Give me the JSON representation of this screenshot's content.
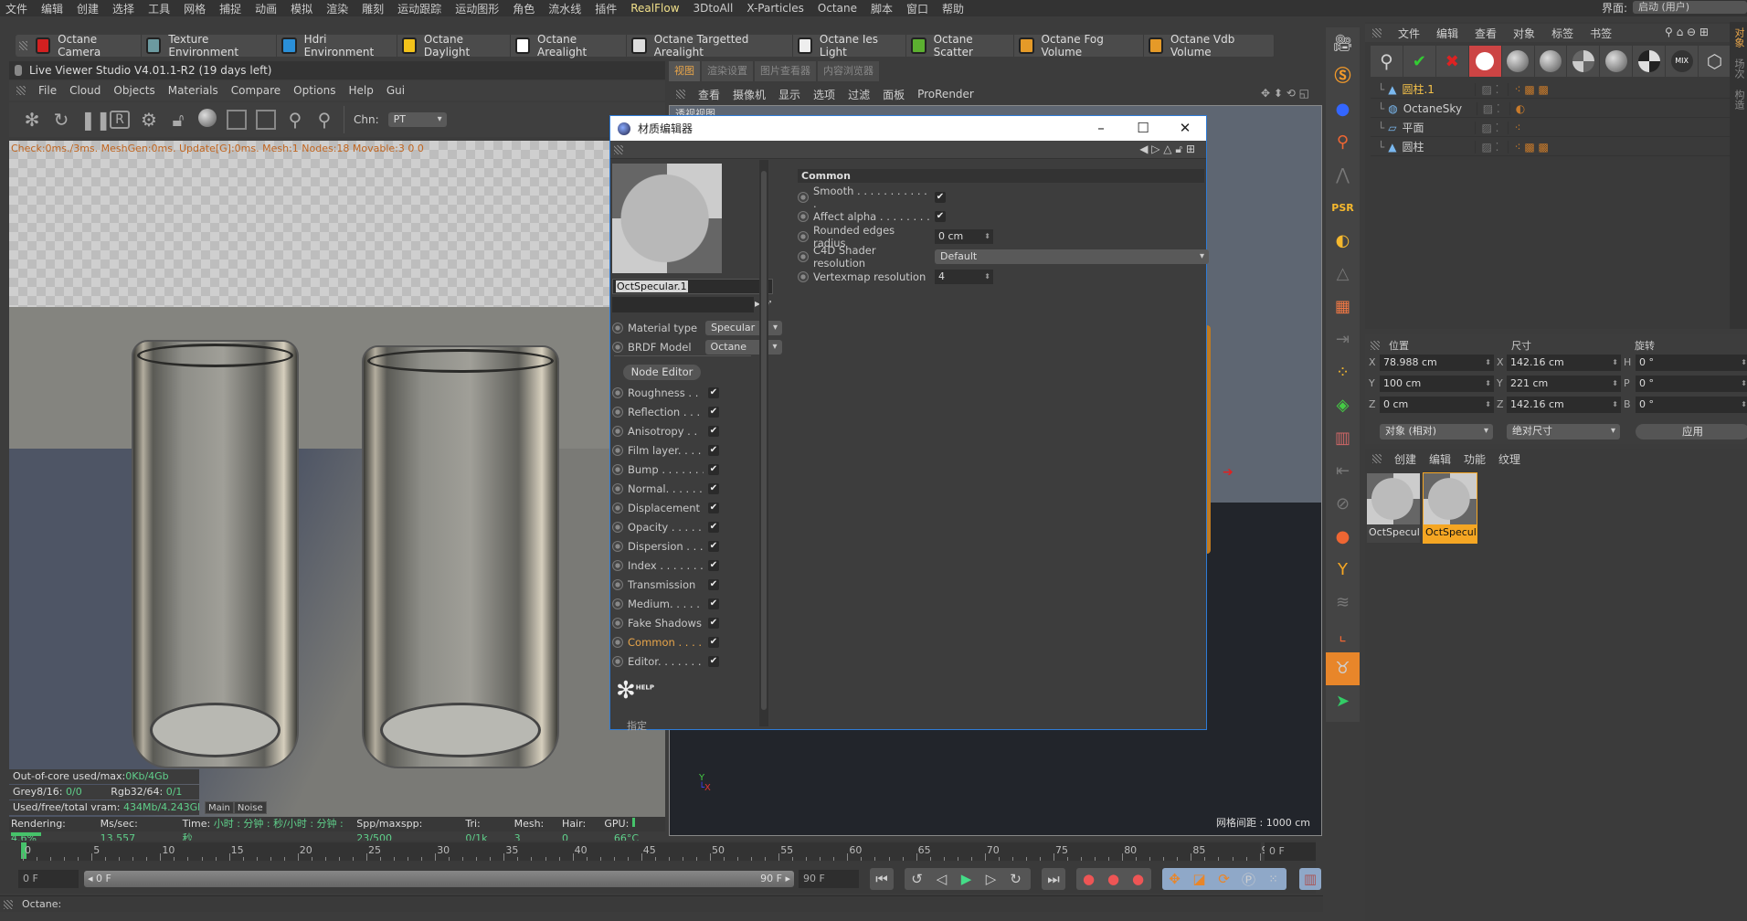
{
  "menubar": {
    "items": [
      "文件",
      "编辑",
      "创建",
      "选择",
      "工具",
      "网格",
      "捕捉",
      "动画",
      "模拟",
      "渲染",
      "雕刻",
      "运动跟踪",
      "运动图形",
      "角色",
      "流水线",
      "插件",
      "RealFlow",
      "3DtoAll",
      "X-Particles",
      "Octane",
      "脚本",
      "窗口",
      "帮助"
    ],
    "highlight": "RealFlow"
  },
  "interface": {
    "label": "界面:",
    "value": "启动 (用户)"
  },
  "octane_toolbar": [
    {
      "label": "Octane Camera",
      "icon": "camera-icon",
      "color": "#d32020"
    },
    {
      "label": "Texture Environment",
      "icon": "texture-env-icon",
      "color": "#6c9aa0"
    },
    {
      "label": "Hdri Environment",
      "icon": "hdri-env-icon",
      "color": "#2a8fd8"
    },
    {
      "label": "Octane Daylight",
      "icon": "sun-icon",
      "color": "#f2c21a"
    },
    {
      "label": "Octane Arealight",
      "icon": "arealight-icon",
      "color": "#ffffff"
    },
    {
      "label": "Octane Targetted Arealight",
      "icon": "targetted-light-icon",
      "color": "#dddddd"
    },
    {
      "label": "Octane Ies Light",
      "icon": "ies-light-icon",
      "color": "#eeeeee"
    },
    {
      "label": "Octane Scatter",
      "icon": "scatter-icon",
      "color": "#5cb030"
    },
    {
      "label": "Octane Fog Volume",
      "icon": "fog-volume-icon",
      "color": "#e59a28"
    },
    {
      "label": "Octane Vdb Volume",
      "icon": "vdb-volume-icon",
      "color": "#e59a28"
    }
  ],
  "live_viewer": {
    "title": "Live Viewer Studio V4.01.1-R2 (19 days left)",
    "menu": [
      "File",
      "Cloud",
      "Objects",
      "Materials",
      "Compare",
      "Options",
      "Help",
      "Gui"
    ],
    "channel_label": "Chn:",
    "channel_value": "PT",
    "overlay_status": "Check:0ms./3ms. MeshGen:0ms. Update[G]:0ms. Mesh:1 Nodes:18 Movable:3  0 0",
    "stats": {
      "out_of_core_label": "Out-of-core used/max:",
      "out_of_core_value": "0Kb/4Gb",
      "grey_label": "Grey8/16:",
      "grey_value": "0/0",
      "rgb_label": "Rgb32/64:",
      "rgb_value": "0/1",
      "vram_label": "Used/free/total vram:",
      "vram_value": "434Mb/4.243Gb/6Gb"
    },
    "tabs": [
      "Main",
      "Noise"
    ],
    "render_status": {
      "rendering_label": "Rendering:",
      "rendering_value": "4.6%",
      "progress": 4.6,
      "ms_label": "Ms/sec:",
      "ms_value": "13.557",
      "time_label": "Time:",
      "time_value": "小时 : 分钟 : 秒/小时 : 分钟 : 秒",
      "spp_label": "Spp/maxspp:",
      "spp_value": "23/500",
      "tri_label": "Tri:",
      "tri_value": "0/1k",
      "mesh_label": "Mesh:",
      "mesh_value": "3",
      "hair_label": "Hair:",
      "hair_value": "0",
      "gpu_label": "GPU:",
      "gpu_temp": "66°C"
    }
  },
  "viewport": {
    "tabs": [
      "视图",
      "渲染设置",
      "图片查看器",
      "内容浏览器"
    ],
    "menu": [
      "查看",
      "摄像机",
      "显示",
      "选项",
      "过滤",
      "面板",
      "ProRender"
    ],
    "label": "透视视图",
    "grid_spacing": "网格间距 : 1000 cm"
  },
  "material_editor": {
    "title": "材质编辑器",
    "material_name": "OctSpecular.1",
    "material_type_label": "Material type",
    "material_type": "Specular",
    "brdf_label": "BRDF Model",
    "brdf": "Octane",
    "node_editor": "Node Editor",
    "channels": [
      {
        "label": "Roughness . .",
        "checked": true
      },
      {
        "label": "Reflection . . .",
        "checked": true
      },
      {
        "label": "Anisotropy . .",
        "checked": true
      },
      {
        "label": "Film layer. . . .",
        "checked": true
      },
      {
        "label": "Bump . . . . . . .",
        "checked": true
      },
      {
        "label": "Normal. . . . . .",
        "checked": true
      },
      {
        "label": "Displacement",
        "checked": true
      },
      {
        "label": "Opacity . . . . .",
        "checked": true
      },
      {
        "label": "Dispersion . . .",
        "checked": true
      },
      {
        "label": "Index . . . . . . .",
        "checked": true
      },
      {
        "label": "Transmission",
        "checked": true
      },
      {
        "label": "Medium. . . . .",
        "checked": true
      },
      {
        "label": "Fake Shadows",
        "checked": true
      },
      {
        "label": "Common . . . .",
        "checked": true,
        "active": true
      },
      {
        "label": "Editor. . . . . . .",
        "checked": true
      }
    ],
    "help_label": "HELP",
    "assign_label": "指定",
    "section_title": "Common",
    "smooth_label": "Smooth . . . . . . . . . . . .",
    "smooth": true,
    "affect_alpha_label": "Affect alpha . . . . . . . .",
    "affect_alpha": true,
    "rounded_label": "Rounded edges radius",
    "rounded_value": "0 cm",
    "shader_res_label": "C4D Shader resolution",
    "shader_res_value": "Default",
    "vertexmap_label": "Vertexmap resolution",
    "vertexmap_value": "4"
  },
  "object_manager": {
    "menu": [
      "文件",
      "编辑",
      "查看",
      "对象",
      "标签",
      "书签"
    ],
    "objects": [
      {
        "name": "圆柱.1",
        "selected": true,
        "icon": "cylinder-icon"
      },
      {
        "name": "OctaneSky",
        "icon": "sky-icon"
      },
      {
        "name": "平面",
        "icon": "plane-icon"
      },
      {
        "name": "圆柱",
        "icon": "cylinder-icon"
      }
    ],
    "side_tabs": [
      "对象",
      "场次",
      "构造"
    ]
  },
  "coordinates": {
    "headers": [
      "位置",
      "尺寸",
      "旋转"
    ],
    "rows": [
      {
        "pl": "X",
        "pos": "78.988 cm",
        "sl": "X",
        "size": "142.16 cm",
        "rl": "H",
        "rot": "0 °"
      },
      {
        "pl": "Y",
        "pos": "100 cm",
        "sl": "Y",
        "size": "221 cm",
        "rl": "P",
        "rot": "0 °"
      },
      {
        "pl": "Z",
        "pos": "0 cm",
        "sl": "Z",
        "size": "142.16 cm",
        "rl": "B",
        "rot": "0 °"
      }
    ],
    "mode": "对象 (相对)",
    "size_mode": "绝对尺寸",
    "apply": "应用"
  },
  "material_manager": {
    "menu": [
      "创建",
      "编辑",
      "功能",
      "纹理"
    ],
    "materials": [
      {
        "name": "OctSpecular",
        "selected": false
      },
      {
        "name": "OctSpecular",
        "selected": true
      }
    ]
  },
  "timeline": {
    "ticks": [
      "0",
      "5",
      "10",
      "15",
      "20",
      "25",
      "30",
      "35",
      "40",
      "45",
      "50",
      "55",
      "60",
      "65",
      "70",
      "75",
      "80",
      "85",
      "90"
    ],
    "current_frame": "0 F",
    "start": "0 F",
    "range_start": "0 F",
    "range_end": "90 F",
    "end": "90 F"
  },
  "status_bar": {
    "text": "Octane:"
  },
  "colors": {
    "accent": "#e8a54a",
    "selection": "#f5a623",
    "green": "#46c36a"
  }
}
